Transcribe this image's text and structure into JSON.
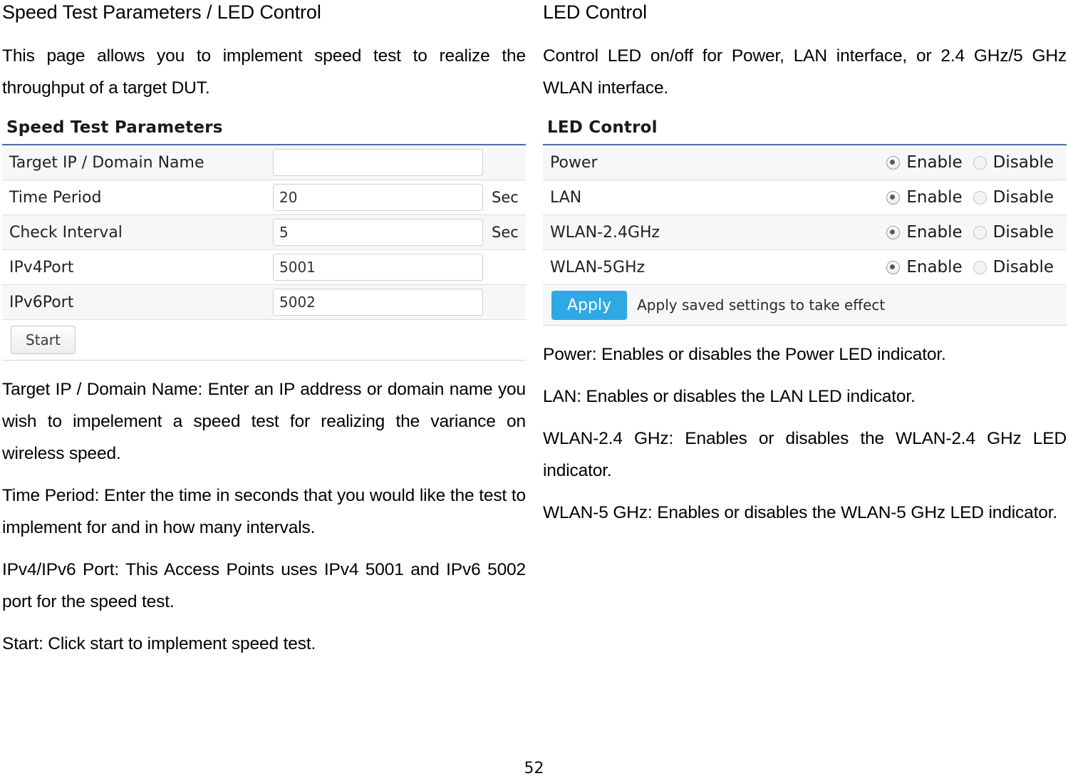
{
  "document": {
    "page_number": "52"
  },
  "left_column": {
    "heading": "Speed Test Parameters / LED Control",
    "intro": "This page allows you to implement speed test to realize the throughput of a target DUT.",
    "speed_test_panel": {
      "title": "Speed Test Parameters",
      "rows": [
        {
          "label": "Target IP / Domain Name",
          "value": "",
          "unit": ""
        },
        {
          "label": "Time Period",
          "value": "20",
          "unit": "Sec"
        },
        {
          "label": "Check Interval",
          "value": "5",
          "unit": "Sec"
        },
        {
          "label": "IPv4Port",
          "value": "5001",
          "unit": ""
        },
        {
          "label": "IPv6Port",
          "value": "5002",
          "unit": ""
        }
      ],
      "start_button": "Start"
    },
    "descriptions": [
      "Target IP / Domain Name: Enter an IP address or domain name you wish to impelement a speed test for realizing the variance on wireless speed.",
      "Time Period: Enter the time in seconds that you would like the test to implement for and in how many intervals.",
      "IPv4/IPv6 Port: This Access Points uses IPv4 5001 and IPv6 5002 port for the speed test.",
      "Start: Click start to implement speed test."
    ]
  },
  "right_column": {
    "heading": "LED Control",
    "intro": "Control LED on/off for Power, LAN interface, or 2.4 GHz/5 GHz WLAN interface.",
    "led_panel": {
      "title": "LED Control",
      "enable_label": "Enable",
      "disable_label": "Disable",
      "rows": [
        {
          "label": "Power",
          "selected": "Enable"
        },
        {
          "label": "LAN",
          "selected": "Enable"
        },
        {
          "label": "WLAN-2.4GHz",
          "selected": "Enable"
        },
        {
          "label": "WLAN-5GHz",
          "selected": "Enable"
        }
      ],
      "apply_button": "Apply",
      "apply_note": "Apply saved settings to take effect"
    },
    "descriptions": [
      "Power: Enables or disables the Power LED indicator.",
      "LAN: Enables or disables the LAN LED indicator.",
      "WLAN-2.4 GHz: Enables or disables the WLAN-2.4 GHz LED indicator.",
      "WLAN-5 GHz: Enables or disables the WLAN-5 GHz LED indicator."
    ]
  },
  "colors": {
    "apply_button": "#2fa9e5",
    "table_top_border": "#4a6fa5",
    "row_shade": "#f6f7f8"
  }
}
